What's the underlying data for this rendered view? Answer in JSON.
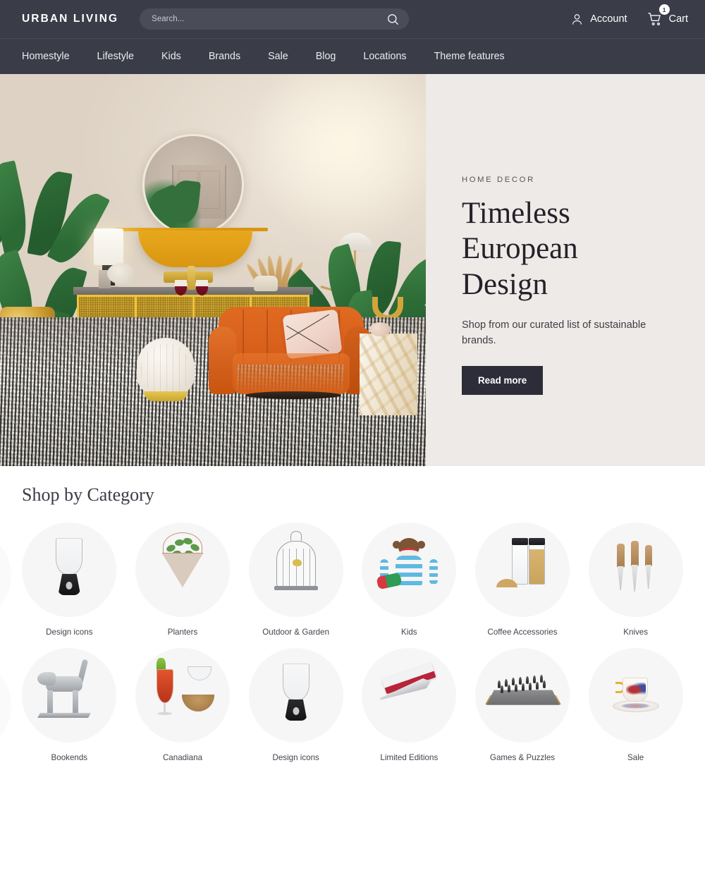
{
  "header": {
    "logo": "URBAN LIVING",
    "search": {
      "placeholder": "Search...",
      "value": "",
      "icon": "search-icon"
    },
    "account": {
      "label": "Account",
      "icon": "user-icon"
    },
    "cart": {
      "label": "Cart",
      "icon": "cart-icon",
      "badge": "1"
    }
  },
  "nav": {
    "items": [
      {
        "label": "Homestyle"
      },
      {
        "label": "Lifestyle"
      },
      {
        "label": "Kids"
      },
      {
        "label": "Brands"
      },
      {
        "label": "Sale"
      },
      {
        "label": "Blog"
      },
      {
        "label": "Locations"
      },
      {
        "label": "Theme features"
      }
    ]
  },
  "hero": {
    "eyebrow": "HOME DECOR",
    "title": "Timeless European Design",
    "subtitle": "Shop from our curated list of sustainable brands.",
    "cta": "Read more",
    "image_alt": "Styled living room with orange armchair, gold rattan sideboard, round mirror and plants",
    "panel_color": "#eeeae7",
    "cta_color": "#2c2d38"
  },
  "categories": {
    "title": "Shop by Category",
    "circle_color": "#f6f6f6",
    "items": [
      {
        "label": "Design icons",
        "art": "goblet"
      },
      {
        "label": "Planters",
        "art": "planter"
      },
      {
        "label": "Outdoor & Garden",
        "art": "birdcage"
      },
      {
        "label": "Kids",
        "art": "sock-monkey"
      },
      {
        "label": "Coffee Accessories",
        "art": "dispensers"
      },
      {
        "label": "Knives",
        "art": "knives"
      },
      {
        "label": "Bookends",
        "art": "dog-bookend"
      },
      {
        "label": "Canadiana",
        "art": "cocktail"
      },
      {
        "label": "Design icons",
        "art": "goblet"
      },
      {
        "label": "Limited Editions",
        "art": "boxed-knife"
      },
      {
        "label": "Games & Puzzles",
        "art": "chess"
      },
      {
        "label": "Sale",
        "art": "teacup"
      }
    ]
  }
}
